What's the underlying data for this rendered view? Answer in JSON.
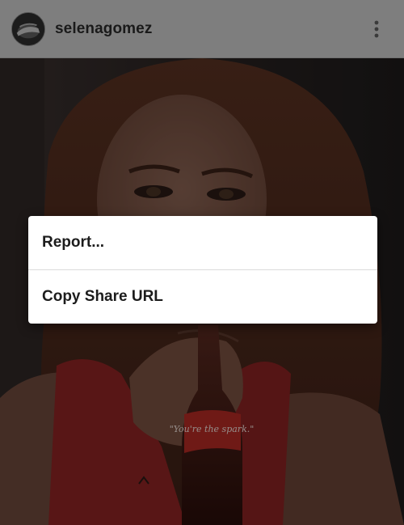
{
  "post": {
    "username": "selenagomez",
    "avatar_icon": "profile-avatar",
    "menu_icon": "more-vertical-icon",
    "photo_text": "\"You're the spark.\""
  },
  "dialog": {
    "items": [
      {
        "label": "Report..."
      },
      {
        "label": "Copy Share URL"
      }
    ]
  },
  "colors": {
    "header_bg": "#7e7e7e",
    "dialog_bg": "#ffffff",
    "text_dark": "#1c1c1c"
  }
}
